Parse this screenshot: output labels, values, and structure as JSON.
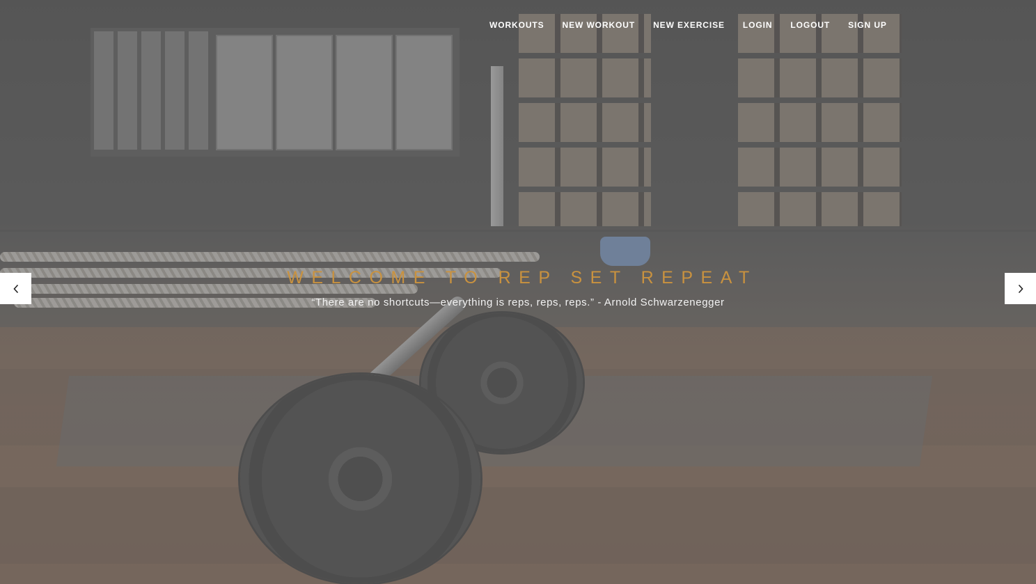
{
  "nav": {
    "items": [
      {
        "label": "WORKOUTS"
      },
      {
        "label": "NEW WORKOUT"
      },
      {
        "label": "NEW EXERCISE"
      },
      {
        "label": "LOGIN"
      },
      {
        "label": "LOGOUT"
      },
      {
        "label": "SIGN UP"
      }
    ]
  },
  "hero": {
    "title": "WELCOME TO REP SET REPEAT",
    "quote": "“There are no shortcuts—everything is reps, reps, reps.” - Arnold Schwarzenegger"
  },
  "carousel": {
    "prev_icon": "chevron-left-icon",
    "next_icon": "chevron-right-icon"
  },
  "colors": {
    "title_accent": "#c9923f",
    "nav_text": "#ffffff",
    "control_bg": "#ffffff"
  }
}
